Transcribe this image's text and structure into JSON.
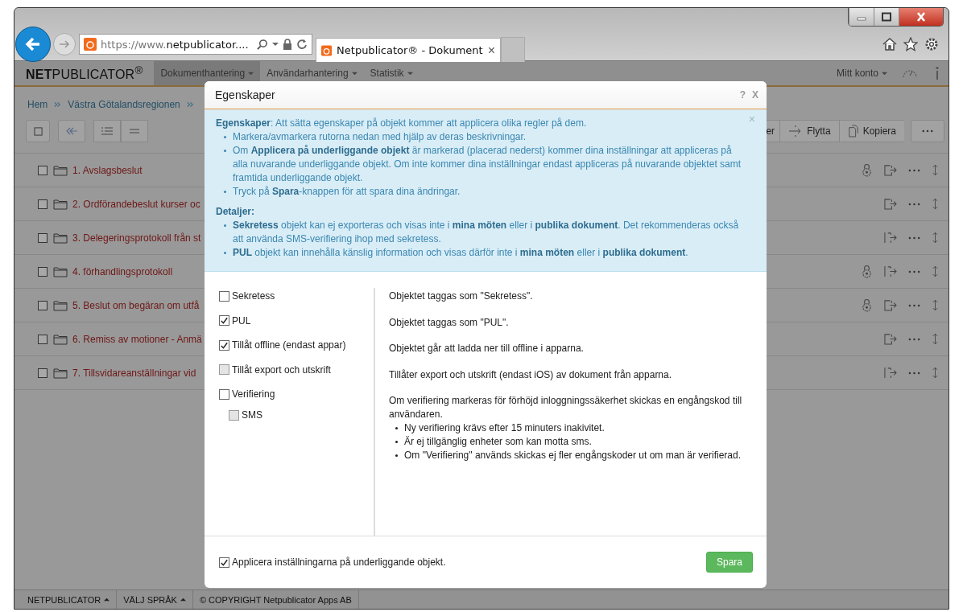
{
  "browser": {
    "address_prefix": "https://www.",
    "address_host": "netpublicator....",
    "tab_title": "Netpublicator® - Dokument",
    "tab_close": "×"
  },
  "navbar": {
    "logo": "**NET**PUBLICATOR$^{®}$",
    "menus": [
      {
        "label": "Dokumenthantering",
        "selected": true
      },
      {
        "label": "Användarhantering",
        "selected": false
      },
      {
        "label": "Statistik",
        "selected": false
      }
    ],
    "account": "Mitt konto"
  },
  "breadcrumb": [
    "Hem",
    "Västra Götalandsregionen"
  ],
  "toolbar": {
    "actions": [
      "er",
      "Flytta",
      "Kopiera"
    ]
  },
  "rows": [
    {
      "title": "1. Avslagsbeslut",
      "checked": false,
      "locked": true,
      "bar_export": false
    },
    {
      "title": "2. Ordförandebeslut kurser oc",
      "checked": false,
      "locked": false,
      "bar_export": false
    },
    {
      "title": "3. Delegeringsprotokoll från st",
      "checked": false,
      "locked": false,
      "bar_export": true
    },
    {
      "title": "4. förhandlingsprotokoll",
      "checked": false,
      "locked": true,
      "bar_export": true
    },
    {
      "title": "5. Beslut om begäran om utfå",
      "checked": false,
      "locked": true,
      "bar_export": false
    },
    {
      "title": "6. Remiss av motioner - Anmä",
      "checked": false,
      "locked": false,
      "bar_export": false
    },
    {
      "title": "7. Tillsvidareanställningar vid",
      "checked": false,
      "locked": false,
      "bar_export": true
    }
  ],
  "modal": {
    "title": "Egenskaper",
    "help": "?",
    "close": "X",
    "info": {
      "close": "×",
      "intro": "**Egenskaper**: Att sätta egenskaper på objekt kommer att applicera olika regler på dem.",
      "bullets": [
        "Markera/avmarkera rutorna nedan med hjälp av deras beskrivningar.",
        "Om **Applicera på underliggande objekt** är markerad (placerad nederst) kommer dina inställningar att appliceras på alla nuvarande underliggande objekt. Om inte kommer dina inställningar endast appliceras på nuvarande objektet samt framtida underliggande objekt.",
        "Tryck på **Spara**-knappen för att spara dina ändringar."
      ],
      "details_heading": "Detaljer:",
      "details": [
        "**Sekretess** objekt kan ej exporteras och visas inte i **mina möten** eller i **publika dokument**. Det rekommenderas också att använda SMS-verifiering ihop med sekretess.",
        "**PUL** objekt kan innehålla känslig information och visas därför inte i **mina möten** eller i **publika dokument**."
      ]
    },
    "options": [
      {
        "label": "Sekretess",
        "checked": false,
        "disabled": false,
        "description": "Objektet taggas som \"Sekretess\"."
      },
      {
        "label": "PUL",
        "checked": true,
        "disabled": false,
        "description": "Objektet taggas som \"PUL\"."
      },
      {
        "label": "Tillåt offline (endast appar)",
        "checked": true,
        "disabled": false,
        "description": "Objektet går att ladda ner till offline i apparna."
      },
      {
        "label": "Tillåt export och utskrift",
        "checked": false,
        "disabled": true,
        "description": "Tillåter export och utskrift (endast iOS) av dokument från apparna."
      },
      {
        "label": "Verifiering",
        "checked": false,
        "disabled": false,
        "description": "Om verifiering markeras för förhöjd inloggningssäkerhet skickas en engångskod till användaren.",
        "children": [
          {
            "label": "SMS",
            "checked": false,
            "disabled": true
          }
        ],
        "notes": [
          "Ny verifiering krävs efter 15 minuters inakivitet.",
          "Är ej tillgänglig enheter som kan motta sms.",
          "Om \"Verifiering\" används skickas ej fler engångskoder ut om man är verifierad."
        ]
      }
    ],
    "apply": {
      "label": "Applicera inställningarna på underliggande objekt.",
      "checked": true
    },
    "save": "Spara"
  },
  "status_bar": [
    {
      "label": "NETPUBLICATOR",
      "caret": true
    },
    {
      "label": "VÄLJ SPRÅK",
      "caret": true
    },
    {
      "label": "© COPYRIGHT Netpublicator Apps AB",
      "caret": false
    }
  ]
}
